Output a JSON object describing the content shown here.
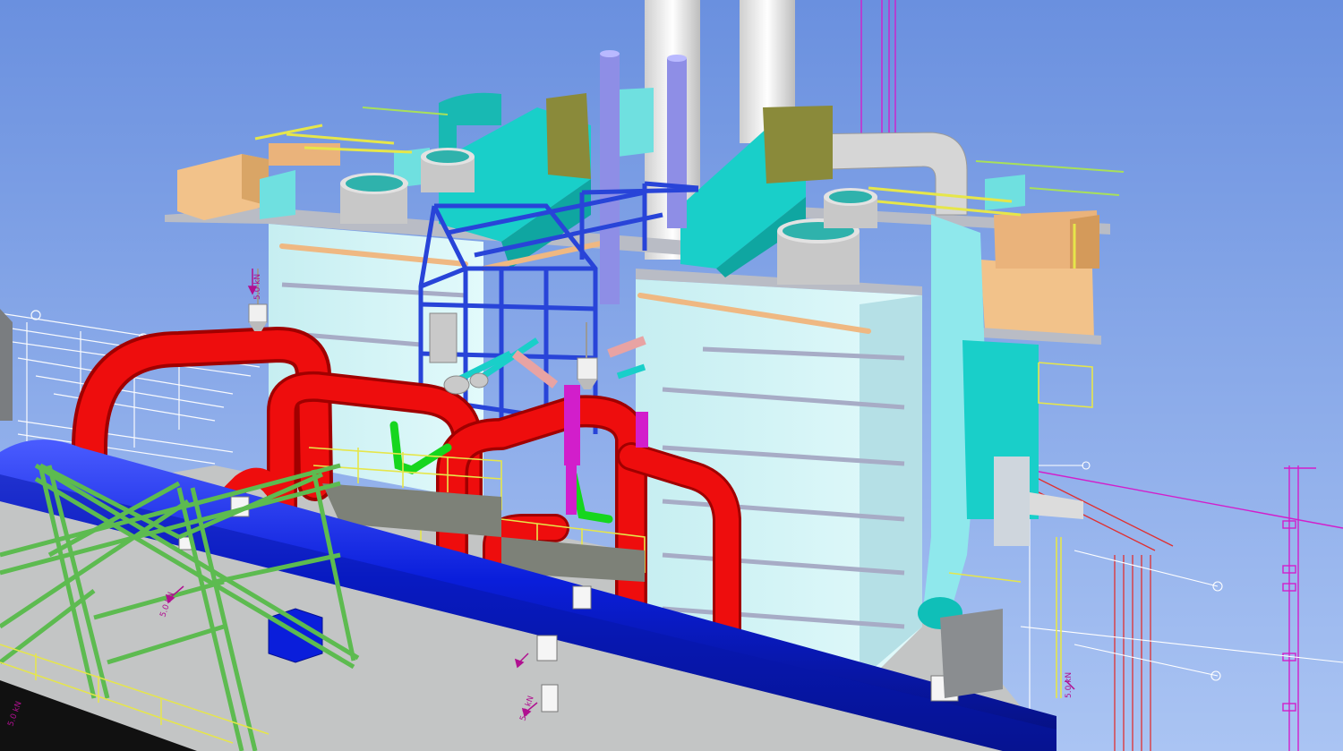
{
  "viewport": {
    "background_top": "#6d93e0",
    "background_bottom": "#a7c1f2"
  },
  "colors": {
    "hot_pipe": "#ee0d0d",
    "main_pipe": "#0a1edb",
    "steel_frame_blue": "#2844d8",
    "steel_frame_green": "#5dbb50",
    "boiler_casing": "#d2f4f6",
    "duct_cyan": "#19cfc9",
    "duct_light_cyan": "#8fe8ec",
    "stack": "#eeeeee",
    "equipment_tan": "#f2c28a",
    "handrail_yellow": "#e6e64a",
    "guide_magenta": "#d21ecb",
    "ground_grey": "#b9bbbb"
  },
  "annotations": {
    "load_tag_left": "5.0 kN",
    "load_tag_mid": "5.0 kN",
    "load_tag_right": "5.0 kN",
    "load_tag_small_left": "5.0 kN",
    "load_tag_small_right": "5.0 kN"
  },
  "icons": [
    "load-arrow-icon",
    "pipe-support-icon",
    "spring-hanger-icon"
  ]
}
